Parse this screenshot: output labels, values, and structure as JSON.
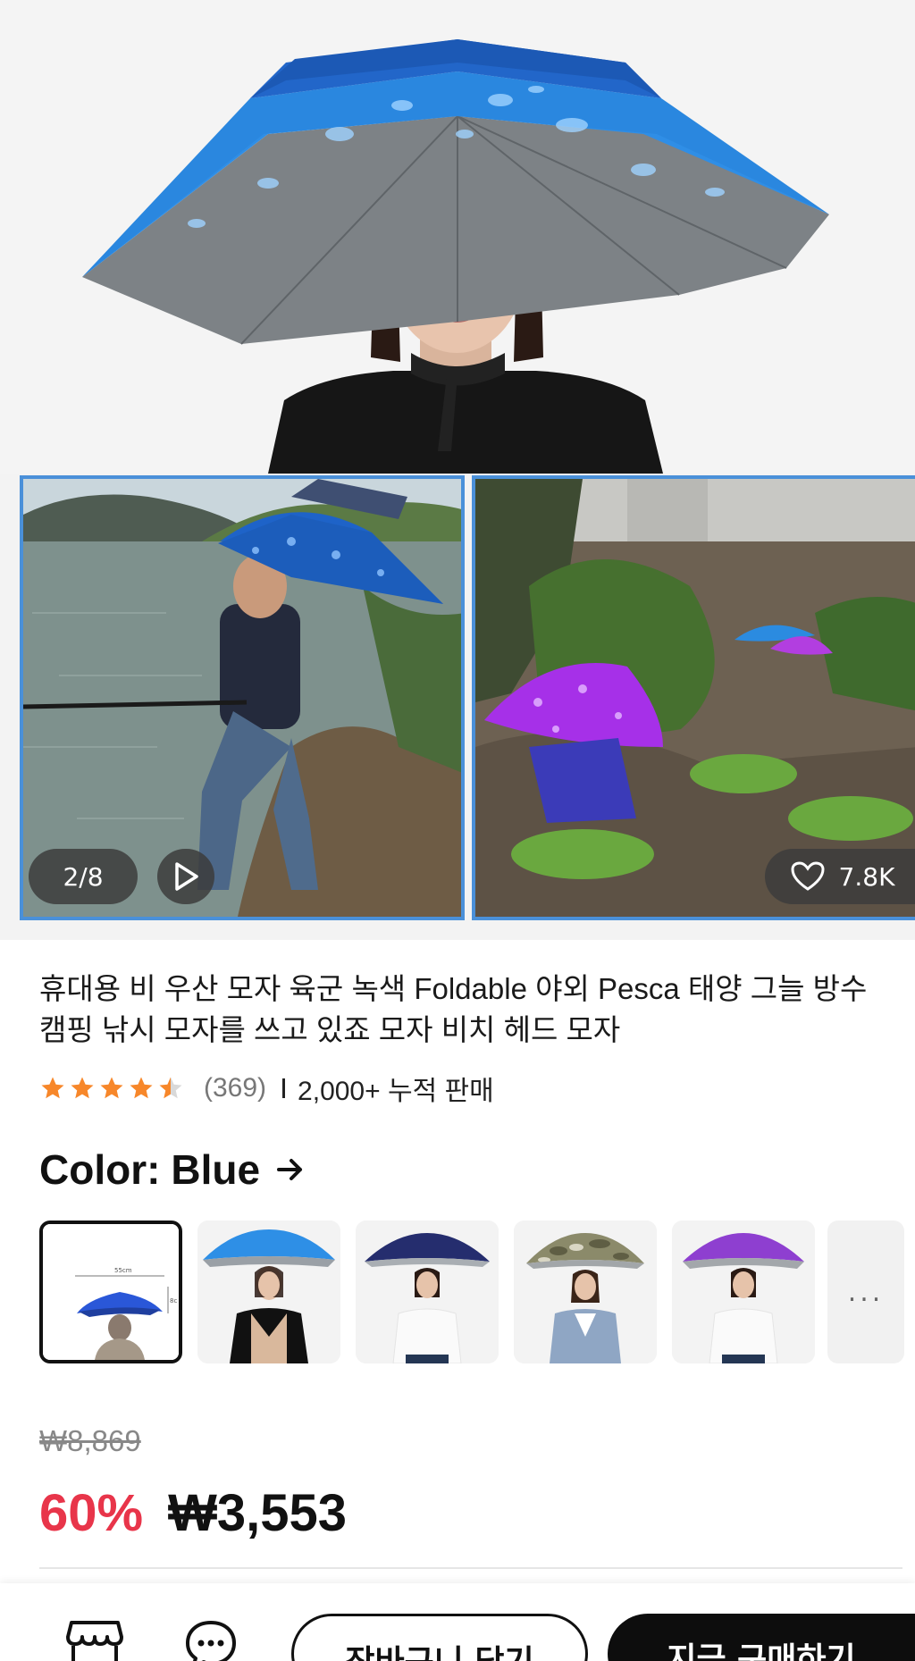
{
  "gallery": {
    "counter": "2/8",
    "likes": "7.8K"
  },
  "product": {
    "title": "휴대용 비 우산 모자 육군 녹색 Foldable 야외 Pesca 태양 그늘 방수 캠핑 낚시 모자를 쓰고 있죠 모자 비치 헤드 모자",
    "rating": 4.5,
    "review_count": "(369)",
    "sold": "2,000+ 누적 판매"
  },
  "color_selector": {
    "label": "Color:",
    "selected": "Blue",
    "options": [
      "blue-size-diagram",
      "sky-blue",
      "navy",
      "camouflage",
      "purple"
    ],
    "more": "..."
  },
  "size_diagram": {
    "width": "55cm",
    "height": "8c"
  },
  "price": {
    "original": "₩8,869",
    "discount": "60%",
    "current": "₩3,553"
  },
  "bottom_bar": {
    "cart_label": "장바구니 담기",
    "buy_label": "지금 구매하기"
  },
  "colors": {
    "accent_red": "#e8354a",
    "panel_border": "#4a90d9",
    "star": "#f7872a"
  }
}
